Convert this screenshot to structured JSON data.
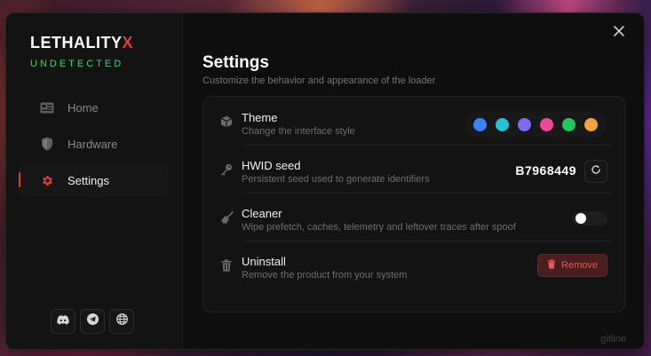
{
  "brand": {
    "name": "LETHALITY",
    "accent": "X",
    "status": "UNDETECTED"
  },
  "nav": [
    {
      "label": "Home",
      "icon": "id-card-icon"
    },
    {
      "label": "Hardware",
      "icon": "shield-icon"
    },
    {
      "label": "Settings",
      "icon": "gear-icon",
      "active": true
    }
  ],
  "socials": [
    "discord-icon",
    "telegram-icon",
    "globe-icon"
  ],
  "page": {
    "title": "Settings",
    "subtitle": "Customize the behavior and appearance of the loader"
  },
  "settings": {
    "theme": {
      "label": "Theme",
      "description": "Change the interface style",
      "colors": [
        "#3b82f6",
        "#22c3d6",
        "#7b6cf6",
        "#ec4899",
        "#22c55e",
        "#f0a43a"
      ]
    },
    "hwid": {
      "label": "HWID seed",
      "description": "Persistent seed used to generate identifiers",
      "value": "B7968449"
    },
    "cleaner": {
      "label": "Cleaner",
      "description": "Wipe prefetch, caches, telemetry and leftover traces after spoof",
      "enabled": false
    },
    "uninstall": {
      "label": "Uninstall",
      "description": "Remove the product from your system",
      "button_label": "Remove"
    }
  },
  "footer": "gitline",
  "colors": {
    "accent": "#e23b3b",
    "status": "#3fd26a",
    "danger_bg": "#4a1d1f",
    "danger_text": "#e15b5b"
  }
}
